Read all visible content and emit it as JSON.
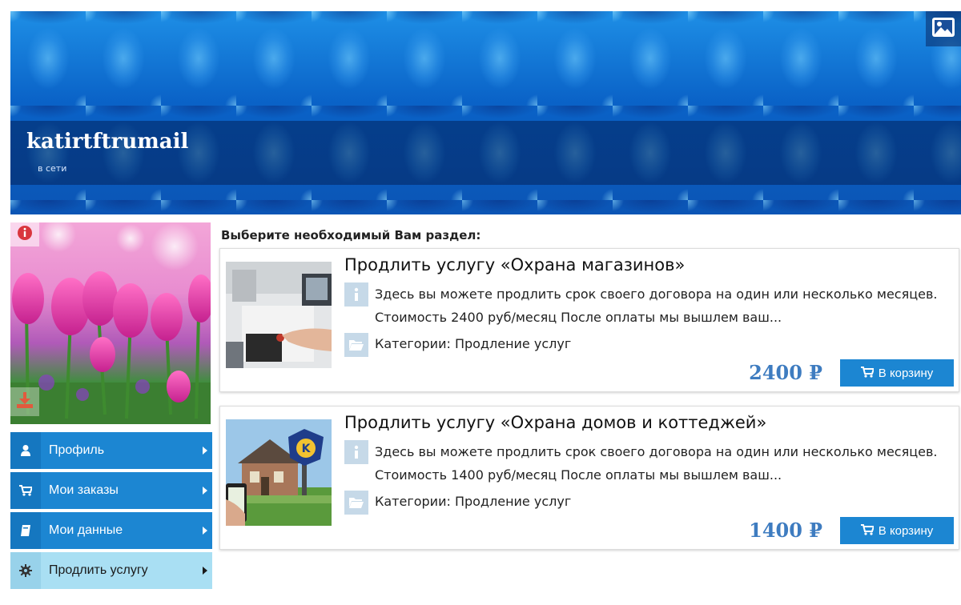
{
  "profile": {
    "username": "katirtftrumail",
    "status": "в сети"
  },
  "icons": {
    "cover": "image-icon",
    "info": "info-icon",
    "download": "download-icon"
  },
  "sidebar": {
    "items": [
      {
        "label": "Профиль",
        "icon": "user-icon",
        "active": false
      },
      {
        "label": "Мои заказы",
        "icon": "cart-icon",
        "active": false
      },
      {
        "label": "Мои данные",
        "icon": "book-icon",
        "active": false
      },
      {
        "label": "Продлить услугу",
        "icon": "gear-icon",
        "active": true
      }
    ]
  },
  "main": {
    "section_title": "Выберите необходимый Вам раздел:",
    "products": [
      {
        "title": "Продлить услугу «Охрана магазинов»",
        "description": "Здесь вы можете продлить срок своего договора на один или несколько месяцев. Стоимость 2400 руб/месяц После оплаты мы вышлем ваш...",
        "category": "Категории: Продление услуг",
        "price": "2400 ₽",
        "cart_label": "В корзину"
      },
      {
        "title": "Продлить услугу «Охрана домов и коттеджей»",
        "description": "Здесь вы можете продлить срок своего договора на один или несколько месяцев. Стоимость 1400 руб/месяц После оплаты мы вышлем ваш...",
        "category": "Категории: Продление услуг",
        "price": "1400 ₽",
        "cart_label": "В корзину"
      }
    ]
  },
  "colors": {
    "accent": "#1c86d2",
    "active_menu": "#a9dff3",
    "price": "#3e7cc0",
    "icon_tile": "#c6d9e8"
  }
}
